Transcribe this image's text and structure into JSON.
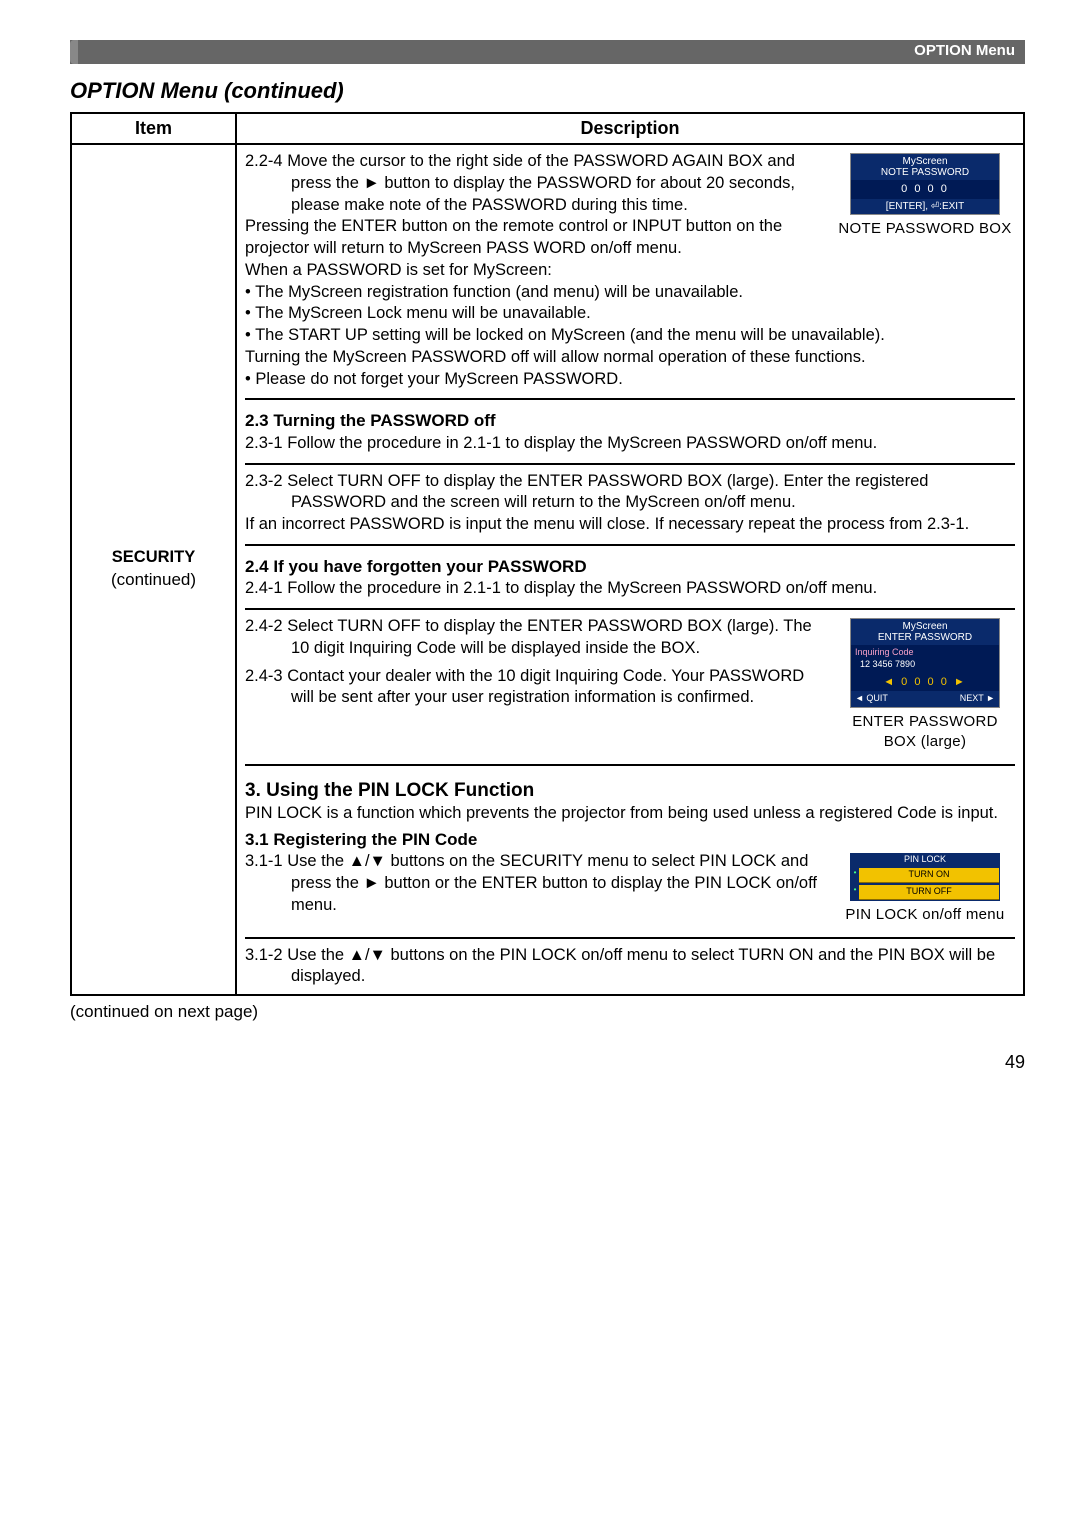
{
  "header": {
    "tab_title": "OPTION Menu"
  },
  "section_heading": "OPTION Menu (continued)",
  "table": {
    "headers": {
      "item": "Item",
      "description": "Description"
    },
    "item_cell": {
      "title": "SECURITY",
      "sub": "(continued)"
    }
  },
  "desc": {
    "p224": {
      "lead": "2.2-4 Move the cursor to the right side of the PASSWORD AGAIN BOX and press the ► button to display the PASSWORD for about 20 seconds, please make note of the PASSWORD during this time.",
      "press": "Pressing the ENTER button on the remote control or INPUT button on the projector will return to MyScreen PASS WORD on/off menu.",
      "when": "When a PASSWORD is set for MyScreen:",
      "b1": "• The MyScreen registration function (and menu) will be unavailable.",
      "b2": "• The MyScreen Lock menu will be unavailable.",
      "b3": "• The START UP setting will be locked on MyScreen (and the menu will be unavailable).",
      "turn": "Turning the MyScreen PASSWORD off will allow normal operation of these functions.",
      "b4": "• Please do not forget your MyScreen PASSWORD."
    },
    "s23": {
      "title": "2.3 Turning the PASSWORD off",
      "p1": "2.3-1 Follow the procedure in 2.1-1 to display the MyScreen PASSWORD on/off menu.",
      "p2": "2.3-2 Select TURN OFF to display the ENTER PASSWORD BOX (large). Enter the registered PASSWORD and the screen will return to the MyScreen on/off menu.",
      "p2b": "If an incorrect PASSWORD is input the menu will close. If necessary repeat the process from 2.3-1."
    },
    "s24": {
      "title": "2.4 If you have forgotten your PASSWORD",
      "p1": "2.4-1 Follow the procedure in 2.1-1 to display the MyScreen PASSWORD on/off menu.",
      "p2": "2.4-2 Select TURN OFF to display the ENTER PASSWORD BOX (large). The 10 digit Inquiring Code will be displayed inside the BOX.",
      "p3": "2.4-3 Contact your dealer with the 10 digit Inquiring Code. Your PASSWORD will be sent after your user registration information is confirmed."
    },
    "s3": {
      "title": "3. Using the PIN LOCK Function",
      "intro": "PIN LOCK is a function which prevents the projector from being used unless a registered Code is input.",
      "s31_title": "3.1 Registering the PIN Code",
      "p311": "3.1-1 Use the ▲/▼ buttons on the SECURITY menu to select PIN LOCK and press the ► button or the ENTER button to display the PIN LOCK on/off menu.",
      "p312": "3.1-2 Use the ▲/▼ buttons on the PIN LOCK on/off menu to select TURN ON and the PIN BOX will be displayed."
    }
  },
  "ui": {
    "note_box": {
      "l1": "MyScreen",
      "l2": "NOTE PASSWORD",
      "digits": "0 0 0 0",
      "hint": "[ENTER], ⏎:EXIT",
      "caption": "NOTE PASSWORD BOX"
    },
    "enter_box": {
      "l1": "MyScreen",
      "l2": "ENTER PASSWORD",
      "inq_label": "Inquiring Code",
      "inq_code": "12 3456 7890",
      "digits": "◄ 0 0 0 0 ►",
      "left": "◄ QUIT",
      "right": "NEXT ►",
      "caption": "ENTER PASSWORD BOX (large)"
    },
    "pin_box": {
      "hdr": "PIN LOCK",
      "r1": "TURN ON",
      "r2": "TURN OFF",
      "caption": "PIN LOCK on/off menu"
    }
  },
  "footer": {
    "continued": "(continued on next page)",
    "page_num": "49"
  }
}
